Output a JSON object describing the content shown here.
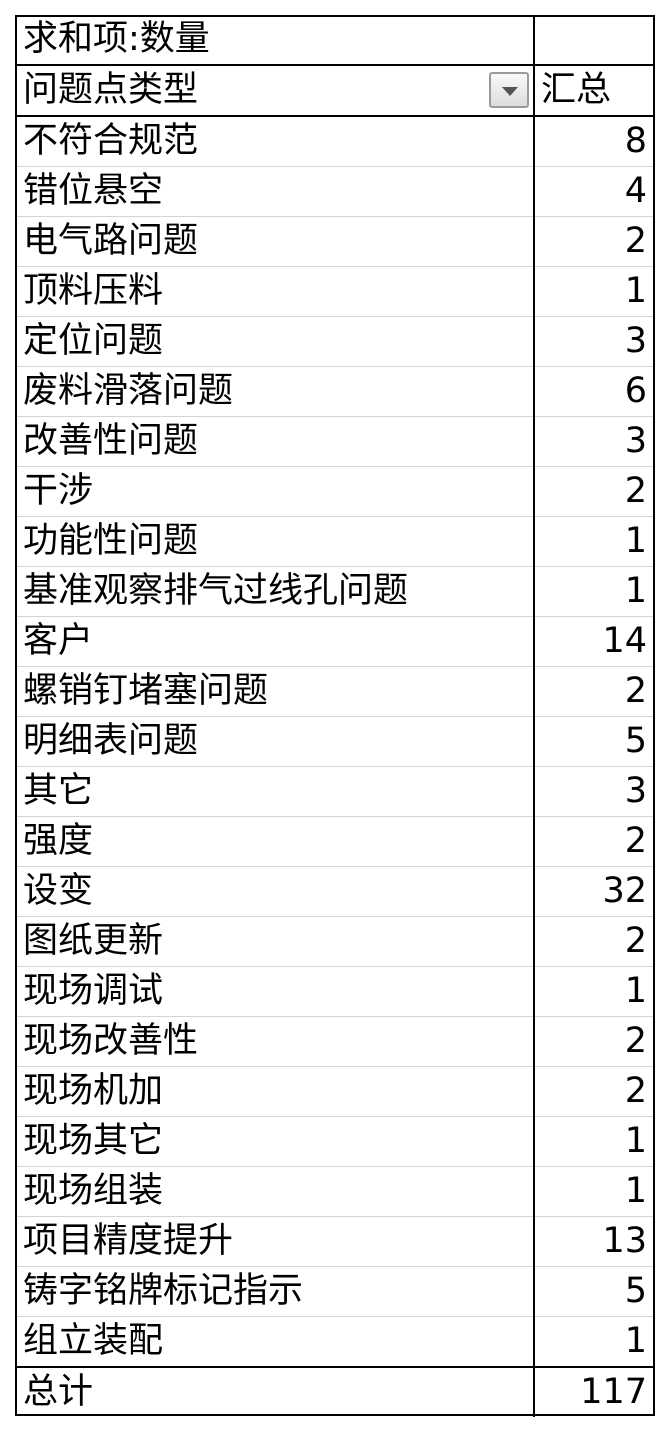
{
  "pivot": {
    "title": "求和项:数量",
    "row_header": "问题点类型",
    "value_header": "汇总",
    "filter_icon": "dropdown-arrow-icon",
    "rows": [
      {
        "label": "不符合规范",
        "value": "8"
      },
      {
        "label": "错位悬空",
        "value": "4"
      },
      {
        "label": "电气路问题",
        "value": "2"
      },
      {
        "label": "顶料压料",
        "value": "1"
      },
      {
        "label": "定位问题",
        "value": "3"
      },
      {
        "label": "废料滑落问题",
        "value": "6"
      },
      {
        "label": "改善性问题",
        "value": "3"
      },
      {
        "label": "干涉",
        "value": "2"
      },
      {
        "label": "功能性问题",
        "value": "1"
      },
      {
        "label": "基准观察排气过线孔问题",
        "value": "1"
      },
      {
        "label": "客户",
        "value": "14"
      },
      {
        "label": "螺销钉堵塞问题",
        "value": "2"
      },
      {
        "label": "明细表问题",
        "value": "5"
      },
      {
        "label": "其它",
        "value": "3"
      },
      {
        "label": "强度",
        "value": "2"
      },
      {
        "label": "设变",
        "value": "32"
      },
      {
        "label": "图纸更新",
        "value": "2"
      },
      {
        "label": "现场调试",
        "value": "1"
      },
      {
        "label": "现场改善性",
        "value": "2"
      },
      {
        "label": "现场机加",
        "value": "2"
      },
      {
        "label": "现场其它",
        "value": "1"
      },
      {
        "label": "现场组装",
        "value": "1"
      },
      {
        "label": "项目精度提升",
        "value": "13"
      },
      {
        "label": "铸字铭牌标记指示",
        "value": "5"
      },
      {
        "label": "组立装配",
        "value": "1"
      }
    ],
    "total_label": "总计",
    "total_value": "117"
  }
}
